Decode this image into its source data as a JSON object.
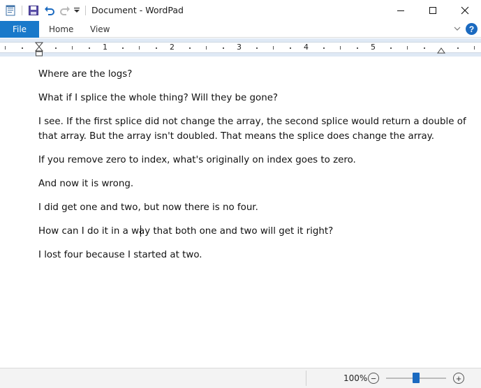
{
  "window": {
    "title": "Document - WordPad",
    "minimize_icon": "minimize-icon",
    "maximize_icon": "maximize-icon",
    "close_icon": "close-icon"
  },
  "quick_access": {
    "icons": [
      "wordpad-app-icon",
      "save-icon",
      "undo-icon",
      "redo-icon",
      "customize-dropdown-icon"
    ]
  },
  "ribbon": {
    "file_tab": "File",
    "tabs": [
      "Home",
      "View"
    ],
    "help_label": "?",
    "accent_color": "#1979ca"
  },
  "ruler": {
    "numbers": [
      "1",
      "2",
      "3",
      "4",
      "5"
    ]
  },
  "document": {
    "paragraphs": [
      [
        "Where are the logs?"
      ],
      [
        "What if I splice the whole thing? Will they be gone?"
      ],
      [
        "I see. If the first splice did not change the array, the second splice would return a double of",
        "that array. But the array isn't doubled. That means the splice does change the array."
      ],
      [
        "If you remove zero to index, what's originally on index goes to zero."
      ],
      [
        "And now it is wrong."
      ],
      [
        "I did get one and two, but now there is no four."
      ],
      [
        "How can I do it in a way that both one and two will get it right?"
      ],
      [
        "I lost four because I started at two."
      ]
    ]
  },
  "status": {
    "zoom_label": "100%",
    "zoom_out_label": "−",
    "zoom_in_label": "+",
    "zoom_level_fraction": 0.5
  }
}
